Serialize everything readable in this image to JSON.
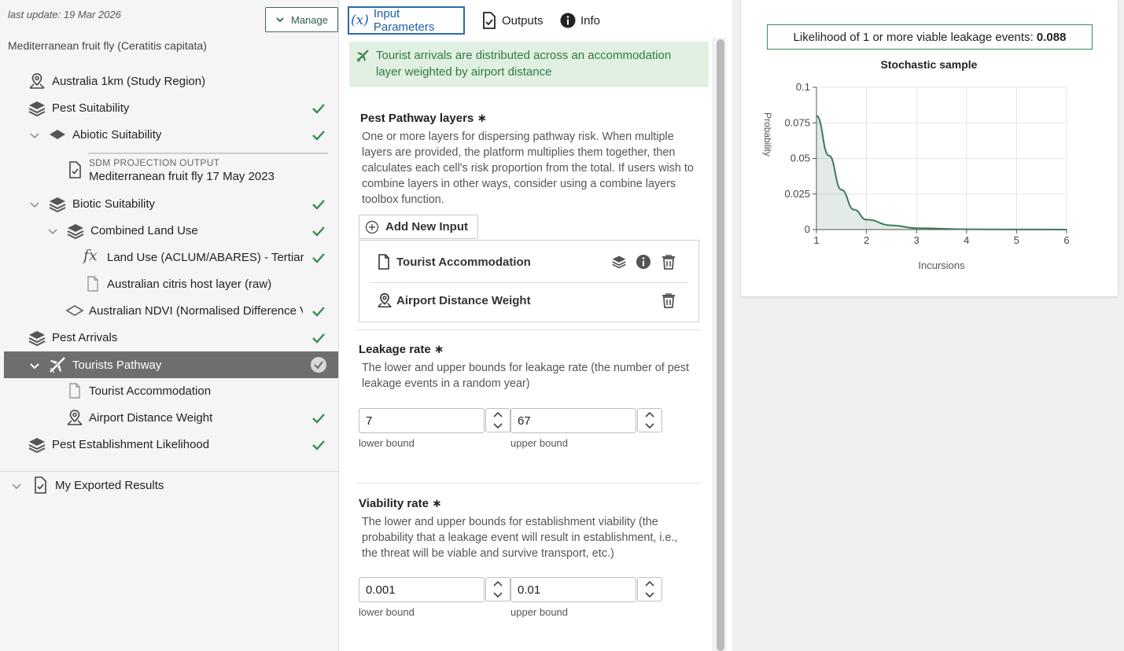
{
  "left_panel": {
    "last_update": "last update: 19 Mar 2026",
    "manage_label": "Manage",
    "species": "Mediterranean fruit fly (Ceratitis capitata)",
    "tree": [
      {
        "label": "Australia 1km (Study Region)",
        "icon": "map-pin-icon",
        "checked": false
      },
      {
        "label": "Pest Suitability",
        "icon": "layers-icon",
        "checked": true
      },
      {
        "label": "Abiotic Suitability",
        "icon": "layer-flat-icon",
        "checked": true
      },
      {
        "sub_label": "SDM PROJECTION OUTPUT",
        "label": "Mediterranean fruit fly 17 May 2023",
        "icon": "document-check-icon"
      },
      {
        "label": "Biotic Suitability",
        "icon": "layers-icon",
        "checked": true
      },
      {
        "label": "Combined Land Use",
        "icon": "layers-icon",
        "checked": true
      },
      {
        "label": "Land Use (ACLUM/ABARES) - Tertiary",
        "icon": "function-icon",
        "checked": true
      },
      {
        "label": "Australian citris host layer (raw)",
        "icon": "file-icon",
        "checked": false
      },
      {
        "label": "Australian NDVI (Normalised Difference Vegetation Index)",
        "icon": "layer-outline-icon",
        "checked": true
      },
      {
        "label": "Pest Arrivals",
        "icon": "layers-icon",
        "checked": true
      },
      {
        "label": "Tourists Pathway",
        "icon": "plane-icon",
        "checked": true,
        "selected": true
      },
      {
        "label": "Tourist Accommodation",
        "icon": "file-icon",
        "checked": false
      },
      {
        "label": "Airport Distance Weight",
        "icon": "map-pin-icon",
        "checked": true
      },
      {
        "label": "Pest Establishment Likelihood",
        "icon": "layers-icon",
        "checked": true
      },
      {
        "label": "My Exported Results",
        "icon": "document-check-icon",
        "checked": false
      }
    ]
  },
  "tabs": [
    {
      "label": "Input Parameters",
      "icon": "variable-icon",
      "active": true
    },
    {
      "label": "Outputs",
      "icon": "document-check-icon"
    },
    {
      "label": "Info",
      "icon": "info-icon"
    }
  ],
  "banner": {
    "icon": "plane-icon",
    "text": "Tourist arrivals are distributed across an accommodation layer weighted by airport distance"
  },
  "pathway_layers": {
    "title": "Pest Pathway layers",
    "required_mark": "∗",
    "description": "One or more layers for dispersing pathway risk. When multiple layers are provided, the platform multiplies them together, then calculates each cell's risk proportion from the total. If users wish to combine layers in other ways, consider using a combine layers toolbox function.",
    "add_label": "Add New Input",
    "layers": [
      {
        "label": "Tourist Accommodation",
        "icon": "file-icon"
      },
      {
        "label": "Airport Distance Weight",
        "icon": "map-pin-icon"
      }
    ]
  },
  "leakage": {
    "title": "Leakage rate",
    "required_mark": "∗",
    "description": "The lower and upper bounds for leakage rate (the number of pest leakage events in a random year)",
    "lower": "7",
    "upper": "67",
    "lower_label": "lower bound",
    "upper_label": "upper bound"
  },
  "viability": {
    "title": "Viability rate",
    "required_mark": "∗",
    "description": "The lower and upper bounds for establishment viability (the probability that a leakage event will result in establishment, i.e., the threat will be viable and survive transport, etc.)",
    "lower": "0.001",
    "upper": "0.01",
    "lower_label": "lower bound",
    "upper_label": "upper bound"
  },
  "result": {
    "likelihood_label": "Likelihood of 1 or more viable leakage events:",
    "likelihood_value": "0.088"
  },
  "chart_data": {
    "type": "area",
    "title": "Stochastic sample",
    "xlabel": "Incursions",
    "ylabel": "Probability",
    "xlim": [
      1,
      6
    ],
    "ylim": [
      0,
      0.1
    ],
    "x_ticks": [
      "1",
      "2",
      "3",
      "4",
      "5",
      "6"
    ],
    "y_ticks": [
      "0",
      "0.025",
      "0.05",
      "0.075",
      "0.1"
    ],
    "grid": true,
    "color": "#3f7a5a",
    "x": [
      1,
      1.25,
      1.5,
      1.75,
      2,
      2.5,
      3,
      4,
      5,
      6
    ],
    "values": [
      0.08,
      0.052,
      0.028,
      0.014,
      0.007,
      0.003,
      0.001,
      0.0002,
      0.0001,
      0.0
    ]
  },
  "colors": {
    "accent_green": "#3b8a58",
    "tab_blue": "#2b6cb0",
    "selected_row": "#6e6e6e"
  }
}
